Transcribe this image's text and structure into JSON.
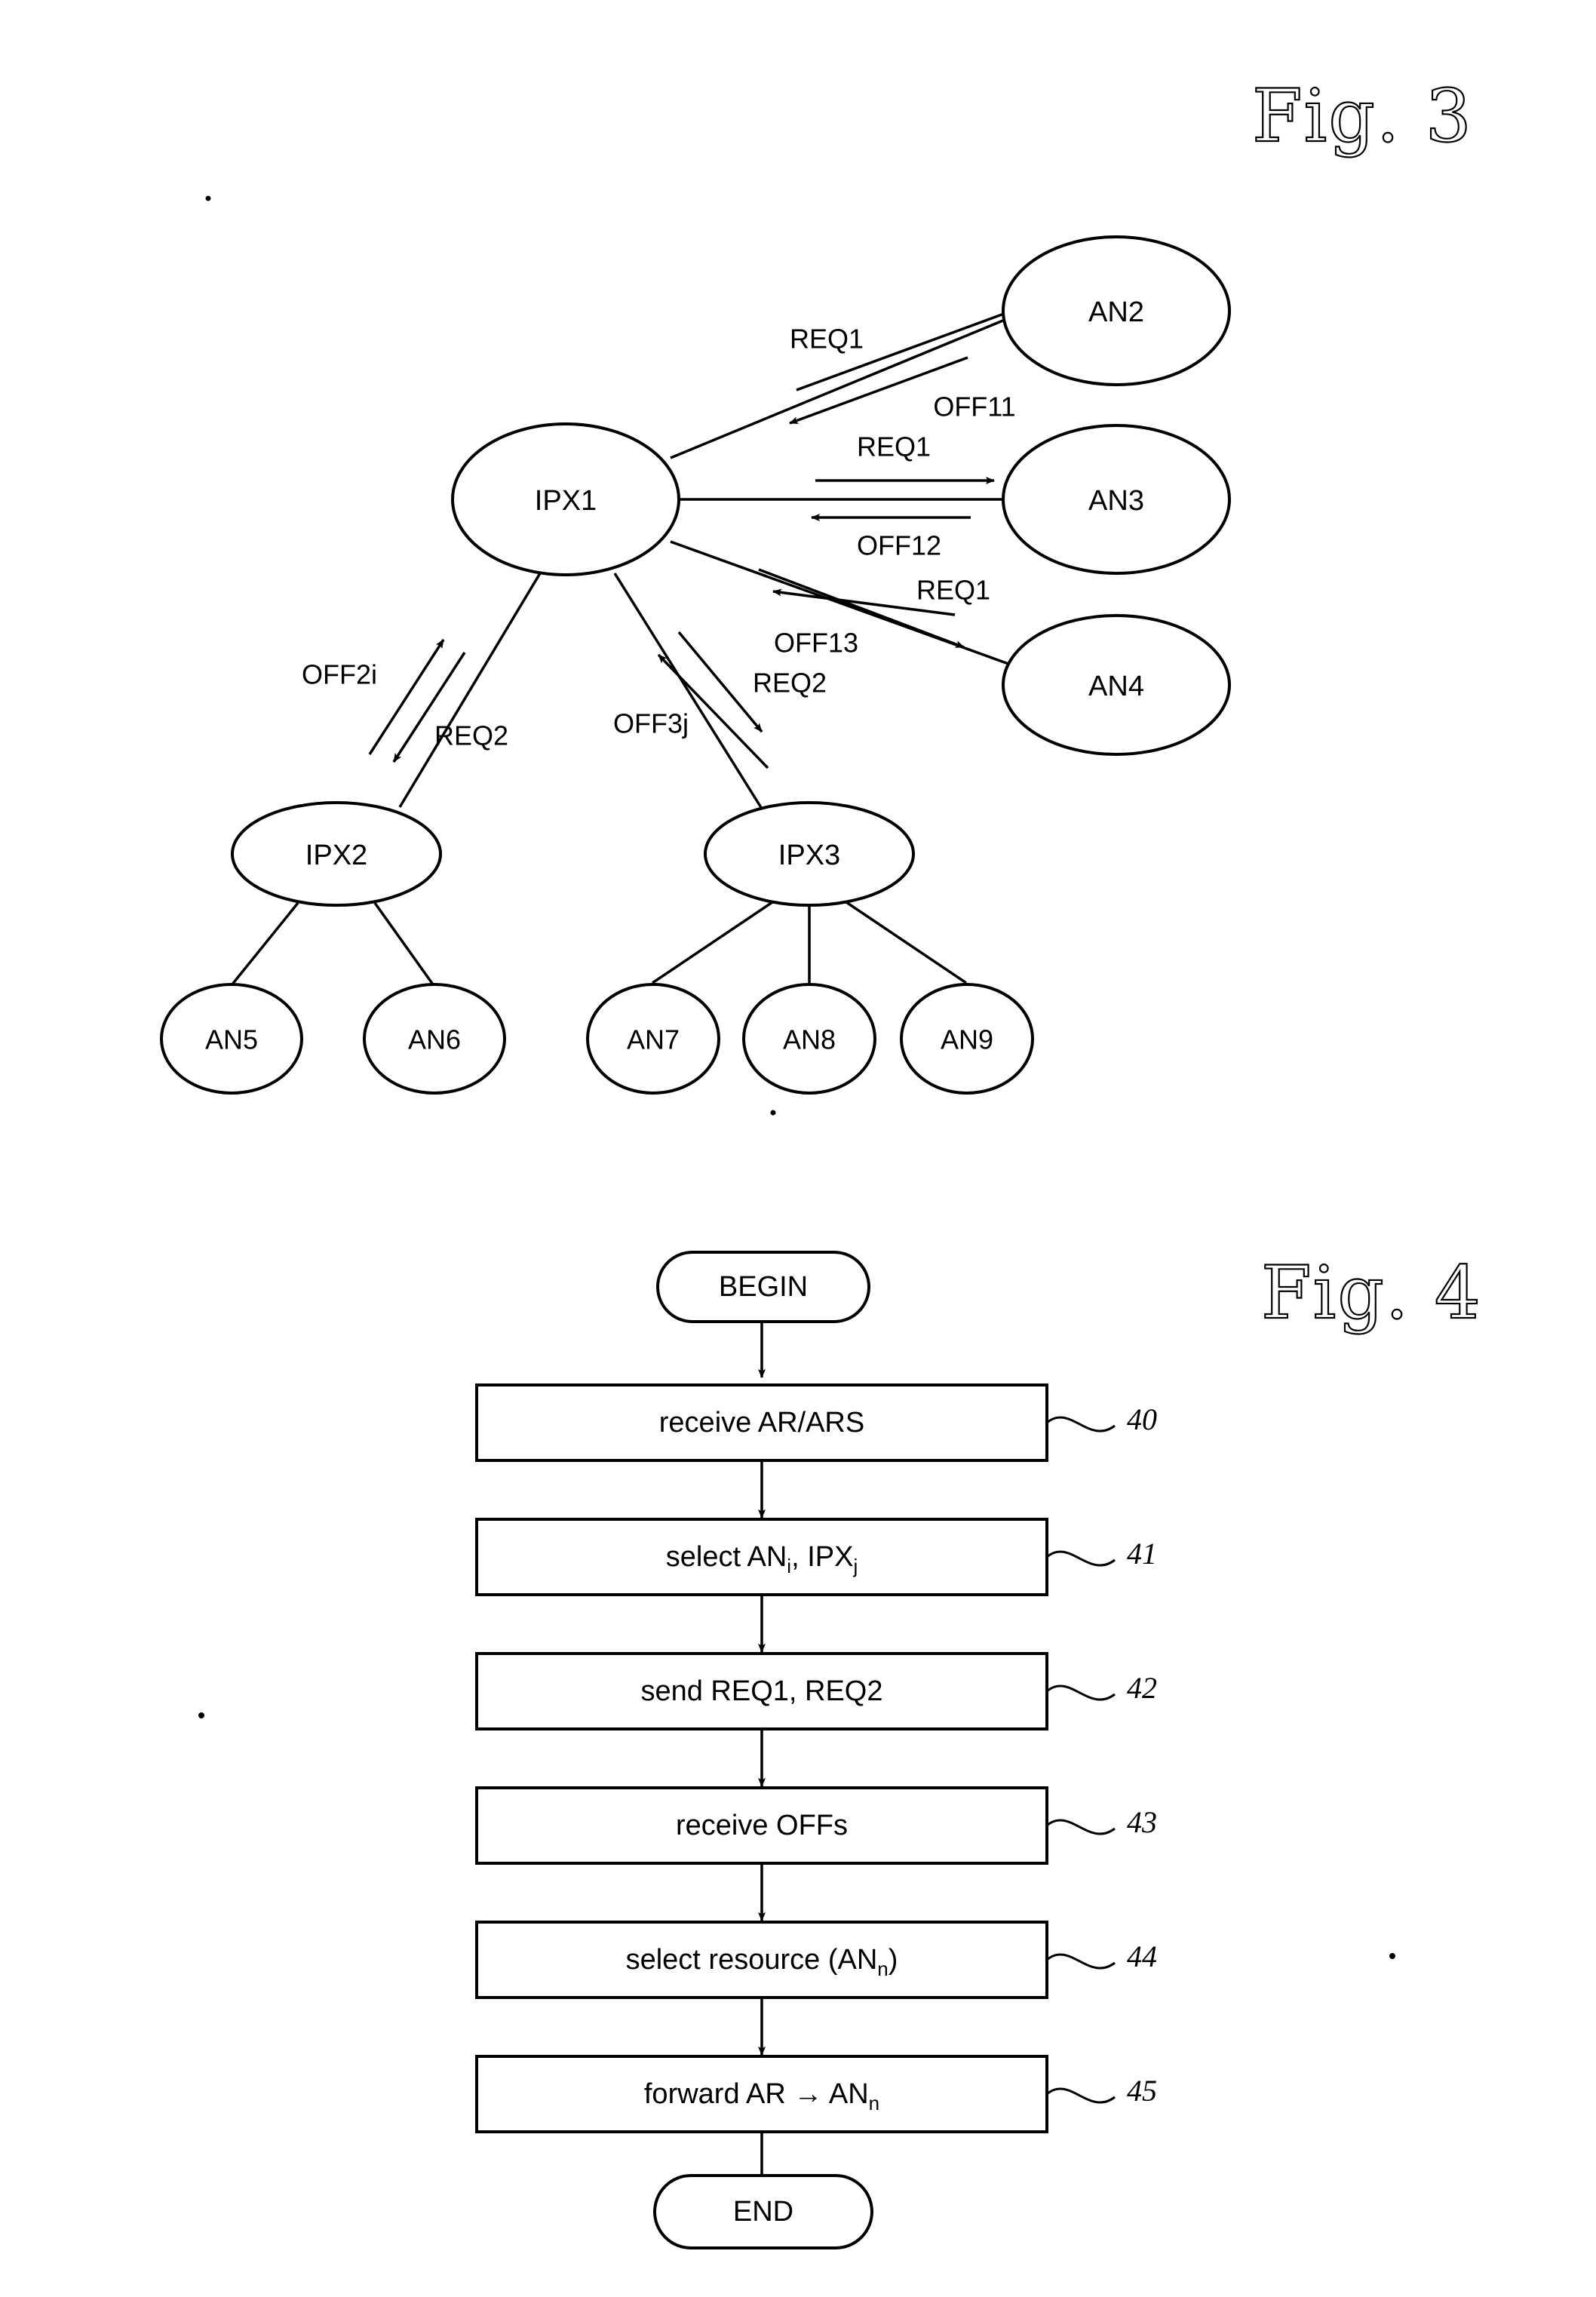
{
  "figures": [
    {
      "id": "fig3",
      "title": "Fig. 3",
      "caption_position": "top-right",
      "type": "network-diagram",
      "nodes": [
        {
          "id": "IPX1",
          "label": "IPX1",
          "kind": "exchange"
        },
        {
          "id": "AN2",
          "label": "AN2",
          "kind": "access-node"
        },
        {
          "id": "AN3",
          "label": "AN3",
          "kind": "access-node"
        },
        {
          "id": "AN4",
          "label": "AN4",
          "kind": "access-node"
        },
        {
          "id": "IPX2",
          "label": "IPX2",
          "kind": "exchange"
        },
        {
          "id": "IPX3",
          "label": "IPX3",
          "kind": "exchange"
        },
        {
          "id": "AN5",
          "label": "AN5",
          "kind": "access-node"
        },
        {
          "id": "AN6",
          "label": "AN6",
          "kind": "access-node"
        },
        {
          "id": "AN7",
          "label": "AN7",
          "kind": "access-node"
        },
        {
          "id": "AN8",
          "label": "AN8",
          "kind": "access-node"
        },
        {
          "id": "AN9",
          "label": "AN9",
          "kind": "access-node"
        }
      ],
      "message_labels": [
        {
          "id": "req1-an2",
          "text": "REQ1",
          "from": "IPX1",
          "to": "AN2"
        },
        {
          "id": "off11",
          "text": "OFF11",
          "from": "AN2",
          "to": "IPX1"
        },
        {
          "id": "req1-an3",
          "text": "REQ1",
          "from": "IPX1",
          "to": "AN3"
        },
        {
          "id": "off12",
          "text": "OFF12",
          "from": "AN3",
          "to": "IPX1"
        },
        {
          "id": "req1-an4",
          "text": "REQ1",
          "from": "IPX1",
          "to": "AN4"
        },
        {
          "id": "off13",
          "text": "OFF13",
          "from": "AN4",
          "to": "IPX1"
        },
        {
          "id": "off2i",
          "text": "OFF2i",
          "from": "IPX2",
          "to": "IPX1"
        },
        {
          "id": "req2-ipx2",
          "text": "REQ2",
          "from": "IPX1",
          "to": "IPX2"
        },
        {
          "id": "off3j",
          "text": "OFF3j",
          "from": "IPX3",
          "to": "IPX1"
        },
        {
          "id": "req2-ipx3",
          "text": "REQ2",
          "from": "IPX1",
          "to": "IPX3"
        }
      ],
      "plain_links": [
        {
          "from": "IPX2",
          "to": "AN5"
        },
        {
          "from": "IPX2",
          "to": "AN6"
        },
        {
          "from": "IPX3",
          "to": "AN7"
        },
        {
          "from": "IPX3",
          "to": "AN8"
        },
        {
          "from": "IPX3",
          "to": "AN9"
        }
      ]
    },
    {
      "id": "fig4",
      "title": "Fig. 4",
      "caption_position": "right",
      "type": "flowchart",
      "terminals": {
        "begin": "BEGIN",
        "end": "END"
      },
      "steps": [
        {
          "ref": "40",
          "text": "receive AR/ARS",
          "base": "receive AR/ARS",
          "sub": "",
          "tail": ""
        },
        {
          "ref": "41",
          "text": "select ANi, IPXj",
          "base": "select AN",
          "sub": "i",
          "tail": ", IPX",
          "sub2": "j"
        },
        {
          "ref": "42",
          "text": "send REQ1, REQ2",
          "base": "send REQ1, REQ2",
          "sub": "",
          "tail": ""
        },
        {
          "ref": "43",
          "text": "receive OFFs",
          "base": "receive OFFs",
          "sub": "",
          "tail": ""
        },
        {
          "ref": "44",
          "text": "select resource (ANn)",
          "base": "select resource (AN",
          "sub": "n",
          "tail": ")"
        },
        {
          "ref": "45",
          "text": "forward AR → ANn",
          "base": "forward  AR → AN",
          "sub": "n",
          "tail": ""
        }
      ]
    }
  ],
  "colors": {
    "ink": "#000000",
    "paper": "#ffffff"
  }
}
